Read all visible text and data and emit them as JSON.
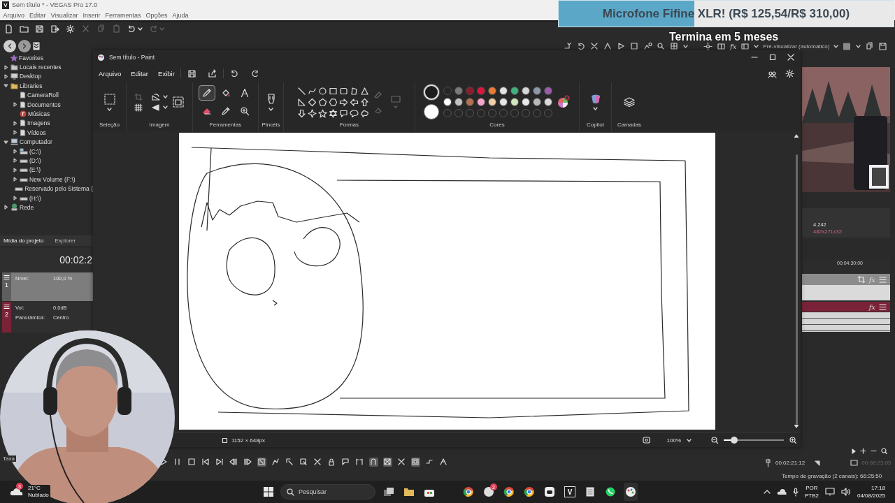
{
  "vegas_window": {
    "app_glyph": "V",
    "title": "Sem título * - VEGAS Pro 17.0",
    "menu": [
      "Arquivo",
      "Editar",
      "Visualizar",
      "Inserir",
      "Ferramentas",
      "Opções",
      "Ajuda"
    ]
  },
  "goal_overlay": {
    "text": "Microfone Fifine XLR! (R$ 125,54/R$ 310,00)",
    "level": 0.405,
    "subtitle": "Termina em 5 meses"
  },
  "explorer_tree": [
    {
      "label": "Favorites",
      "kind": "favorites"
    },
    {
      "label": "Locais recentes",
      "kind": "recent",
      "expanded": false
    },
    {
      "label": "Desktop",
      "kind": "desktop",
      "expanded": false
    },
    {
      "label": "Libraries",
      "kind": "folder",
      "expanded": true,
      "children": [
        {
          "label": "CameraRoll",
          "kind": "document"
        },
        {
          "label": "Documentos",
          "kind": "document",
          "expanded": false
        },
        {
          "label": "Músicas",
          "kind": "music"
        },
        {
          "label": "Imagens",
          "kind": "document",
          "expanded": false
        },
        {
          "label": "Vídeos",
          "kind": "document",
          "expanded": false
        }
      ]
    },
    {
      "label": "Computador",
      "kind": "computer",
      "expanded": true,
      "children": [
        {
          "label": "(C:\\)",
          "kind": "system-drive",
          "expanded": false
        },
        {
          "label": "(D:\\)",
          "kind": "drive",
          "expanded": false
        },
        {
          "label": "(E:\\)",
          "kind": "drive",
          "expanded": false
        },
        {
          "label": "New Volume (F:\\)",
          "kind": "drive",
          "expanded": false
        },
        {
          "label": "Reservado pelo Sistema (",
          "kind": "drive"
        },
        {
          "label": "(H:\\)",
          "kind": "drive",
          "expanded": false
        }
      ]
    },
    {
      "label": "Rede",
      "kind": "network",
      "expanded": false
    }
  ],
  "project_tabs": [
    {
      "label": "Mídia do projeto",
      "selected": true
    },
    {
      "label": "Explorer",
      "selected": false
    }
  ],
  "time_display": "00:02:2",
  "tracks": [
    {
      "number": "1",
      "kind": "video",
      "fields": [
        {
          "label": "Nível:",
          "value": "100,0 %"
        }
      ]
    },
    {
      "number": "2",
      "kind": "audio",
      "fields": [
        {
          "label": "Vol:",
          "value": "0,0dB"
        },
        {
          "label": "Panorâmica:",
          "value": "Centro"
        }
      ]
    }
  ],
  "rate_label": "Taxa",
  "preview": {
    "fx": "fx",
    "mode": "Pré-visualizar (automático)",
    "frame": "4.242",
    "size": "482x271x32"
  },
  "timeline": {
    "ruler_time": "00:04:30:00",
    "track_fx": [
      "fx",
      "fx"
    ],
    "cursor_time": "00:02:21:12",
    "end_time": "00:08:23:05",
    "record_time": "Tempo de gravação (2 canais): 66:25:50"
  },
  "paint": {
    "title": "Sem título - Paint",
    "menu": [
      "Arquivo",
      "Editar",
      "Exibir"
    ],
    "groups": [
      "Seleção",
      "Imagem",
      "Ferramentas",
      "Pincéis",
      "Formas",
      "Cores",
      "Copilot",
      "Camadas"
    ],
    "tools": [
      {
        "kind": "pencil",
        "selected": true
      },
      {
        "kind": "fill",
        "selected": false
      },
      {
        "kind": "text",
        "selected": false
      },
      {
        "kind": "eraser",
        "selected": false
      },
      {
        "kind": "picker",
        "selected": false
      },
      {
        "kind": "magnifier",
        "selected": false
      }
    ],
    "current_colors": [
      {
        "color": "#1c1c1c",
        "selected": true
      },
      {
        "color": "#ffffff",
        "selected": false
      }
    ],
    "palette": [
      {
        "color": "#262626"
      },
      {
        "color": "#7a7a7a"
      },
      {
        "color": "#8a1c2e"
      },
      {
        "color": "#d8173b"
      },
      {
        "color": "#ea7b35"
      },
      {
        "color": "#e2e2e2"
      },
      {
        "color": "#41b07f"
      },
      {
        "color": "#d6d6d6"
      },
      {
        "color": "#8c98a5"
      },
      {
        "color": "#9a5ca8"
      },
      {
        "color": "#ffffff"
      },
      {
        "color": "#c4c4c4"
      },
      {
        "color": "#b4714f"
      },
      {
        "color": "#f2a7c4"
      },
      {
        "color": "#f0cfa6"
      },
      {
        "color": "#e6e6e6"
      },
      {
        "color": "#cfe5c0"
      },
      {
        "color": "#e8e8e8"
      },
      {
        "color": "#b8b8b8"
      },
      {
        "color": "#dadada"
      }
    ],
    "canvas_size": "1152 × 648px",
    "zoom": {
      "value": "100%",
      "level": 0.17
    }
  },
  "taskbar": {
    "weather": {
      "badge": "3",
      "temperature": "21°C",
      "condition": "Nublado"
    },
    "search_placeholder": "Pesquisar",
    "chat_badge": "2",
    "vegas_glyph": "V",
    "language": "POR",
    "layout": "PTB2",
    "time": "17:18",
    "date": "04/08/2025"
  }
}
